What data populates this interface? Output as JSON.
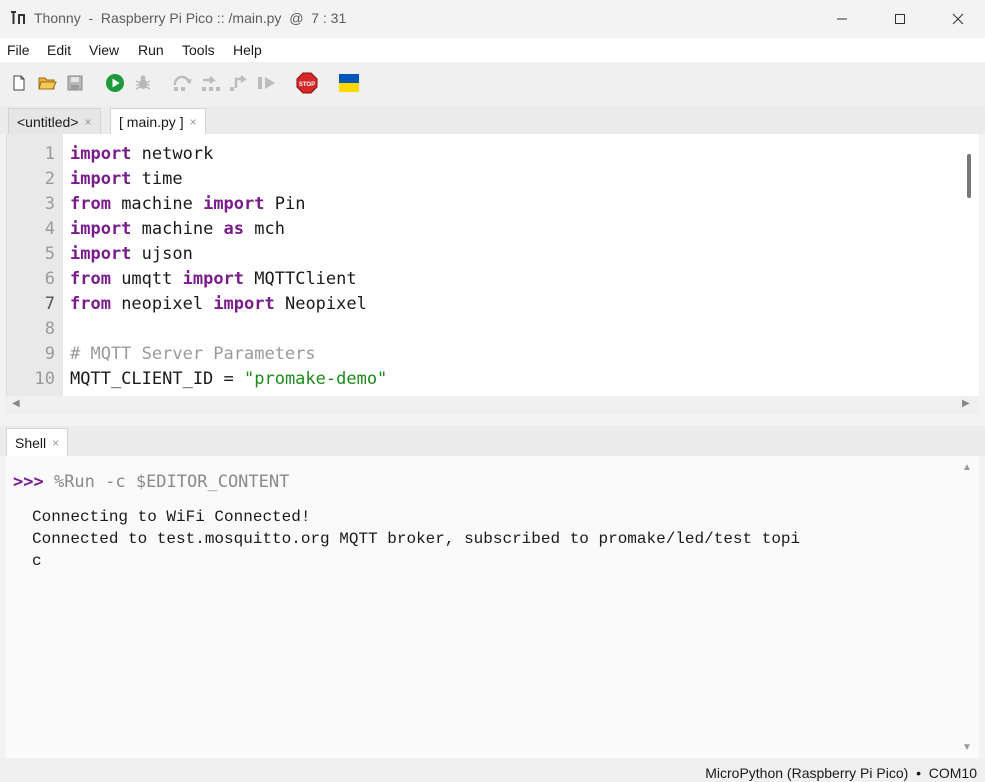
{
  "window": {
    "title": "Thonny  -  Raspberry Pi Pico :: /main.py  @  7 : 31"
  },
  "menu": [
    "File",
    "Edit",
    "View",
    "Run",
    "Tools",
    "Help"
  ],
  "toolbar": {
    "icons": [
      "new-file-icon",
      "open-file-icon",
      "save-icon",
      "run-icon",
      "debug-icon",
      "step-over-icon",
      "step-into-icon",
      "step-out-icon",
      "resume-icon",
      "stop-icon",
      "ukraine-flag-icon"
    ],
    "stop_label": "STOP"
  },
  "editor": {
    "tabs": [
      {
        "label": "<untitled>",
        "close": "×"
      },
      {
        "label": "[ main.py ]",
        "close": "×"
      }
    ],
    "lines": [
      {
        "n": "1",
        "kw1": "import",
        "rest1": " network"
      },
      {
        "n": "2",
        "kw1": "import",
        "rest1": " time"
      },
      {
        "n": "3",
        "kw1": "from",
        "rest1": " machine ",
        "kw2": "import",
        "rest2": " Pin"
      },
      {
        "n": "4",
        "kw1": "import",
        "rest1": " machine ",
        "kw2": "as",
        "rest2": " mch"
      },
      {
        "n": "5",
        "kw1": "import",
        "rest1": " ujson"
      },
      {
        "n": "6",
        "kw1": "from",
        "rest1": " umqtt ",
        "kw2": "import",
        "rest2": " MQTTClient"
      },
      {
        "n": "7",
        "kw1": "from",
        "rest1": " neopixel ",
        "kw2": "import",
        "rest2": " Neopixel"
      },
      {
        "n": "8"
      },
      {
        "n": "9",
        "comment": "# MQTT Server Parameters"
      },
      {
        "n": "10",
        "plain": "MQTT_CLIENT_ID = ",
        "string": "\"promake-demo\""
      }
    ]
  },
  "shell": {
    "tab_label": "Shell",
    "tab_close": "×",
    "prompt": ">>>",
    "command": " %Run -c $EDITOR_CONTENT",
    "output": [
      "Connecting to WiFi Connected!",
      "Connected to test.mosquitto.org MQTT broker, subscribed to promake/led/test topi",
      "c"
    ]
  },
  "status": {
    "text": "MicroPython (Raspberry Pi Pico)  •  COM10"
  },
  "colors": {
    "keyword": "#7a1d8c",
    "comment": "#9a9a9a",
    "string": "#1c8a1c",
    "run_green": "#1f9a3a",
    "stop_red": "#d62828",
    "flag_blue": "#0057b7",
    "flag_yellow": "#ffd700"
  }
}
